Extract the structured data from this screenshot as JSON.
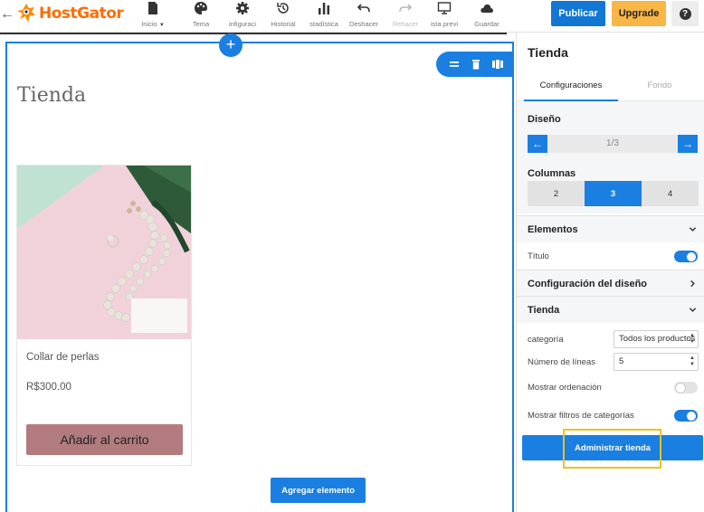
{
  "topbar": {
    "logo_text": "HostGator",
    "tools": [
      {
        "label": "Inicio",
        "icon": "page-icon"
      },
      {
        "label": "Tema",
        "icon": "palette-icon"
      },
      {
        "label": "infiguraci",
        "icon": "gear-icon"
      },
      {
        "label": "Historial",
        "icon": "history-icon"
      },
      {
        "label": "stadística",
        "icon": "bar-chart-icon"
      },
      {
        "label": "Deshacer",
        "icon": "undo-icon"
      },
      {
        "label": "Rehacer",
        "icon": "redo-icon"
      },
      {
        "label": "ista previ",
        "icon": "monitor-icon"
      },
      {
        "label": "Guardar",
        "icon": "cloud-icon"
      }
    ],
    "publish_label": "Publicar",
    "upgrade_label": "Upgrade",
    "help_label": "?"
  },
  "canvas": {
    "add_section_label": "+",
    "shop_title": "Tienda",
    "product": {
      "name": "Collar de perlas",
      "price": "R$300.00",
      "add_to_cart_label": "Añadir al carrito"
    },
    "add_element_label": "Agregar elemento"
  },
  "panel": {
    "title": "Tienda",
    "tabs": [
      "Configuraciones",
      "Fondo"
    ],
    "design_label": "Diseño",
    "design_pager": "1/3",
    "columns_label": "Columnas",
    "columns": [
      "2",
      "3",
      "4"
    ],
    "columns_selected": "3",
    "elements_label": "Elementos",
    "title_toggle_label": "Título",
    "title_toggle_on": true,
    "layout_config_label": "Configuración del diseño",
    "shop_section_label": "Tienda",
    "category_label": "categoría",
    "category_value": "Todos los productos",
    "lines_label": "Número de líneas",
    "lines_value": "5",
    "show_sorting_label": "Mostrar ordenación",
    "show_sorting_on": false,
    "show_filters_label": "Mostrar filtros de categorías",
    "show_filters_on": true,
    "manage_shop_label": "Administrar tienda"
  },
  "colors": {
    "primary": "#1a7fe0",
    "upgrade": "#f8b646",
    "add_to_cart": "#b27c7e",
    "brand": "#ff6b00",
    "highlight": "#e8c41d"
  }
}
